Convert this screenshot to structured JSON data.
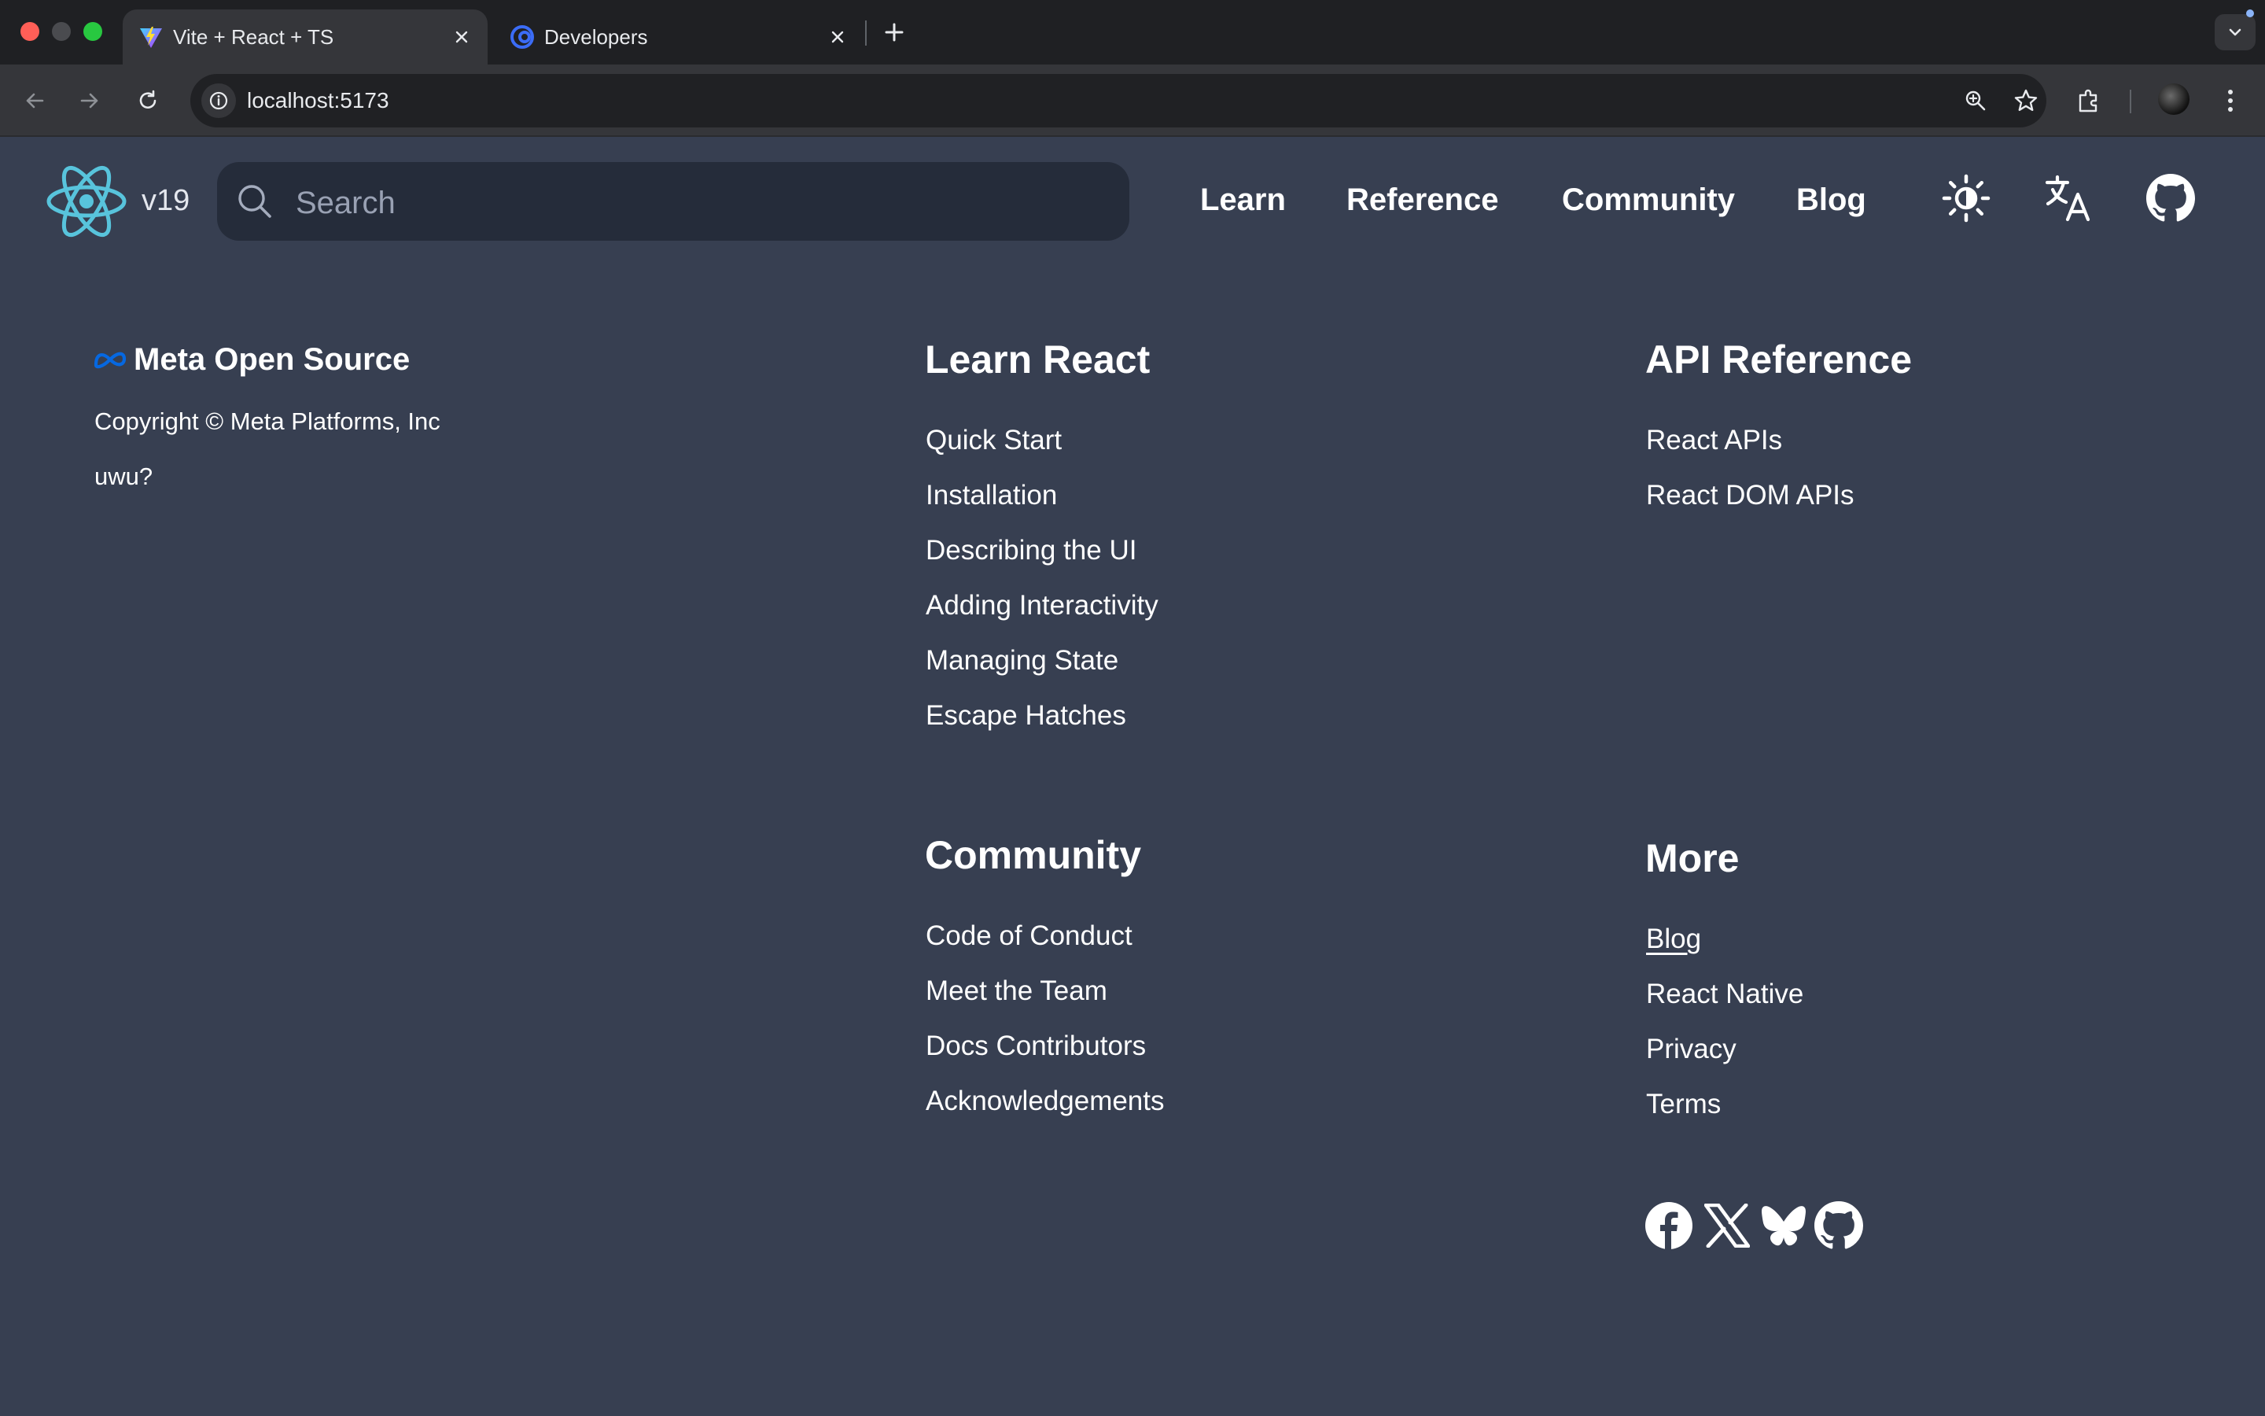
{
  "browser": {
    "tabs": [
      {
        "title": "Vite + React + TS",
        "active": true,
        "favicon": "vite-icon"
      },
      {
        "title": "Developers",
        "active": false,
        "favicon": "developers-icon"
      }
    ],
    "url": "localhost:5173"
  },
  "site": {
    "version": "v19",
    "search_placeholder": "Search",
    "nav": [
      "Learn",
      "Reference",
      "Community",
      "Blog"
    ],
    "nav_icons": [
      "theme-toggle-icon",
      "language-icon",
      "github-icon"
    ]
  },
  "footer": {
    "brand": "Meta Open Source",
    "copyright": "Copyright © Meta Platforms, Inc",
    "uwu": "uwu?",
    "learn": {
      "heading": "Learn React",
      "links": [
        "Quick Start",
        "Installation",
        "Describing the UI",
        "Adding Interactivity",
        "Managing State",
        "Escape Hatches"
      ]
    },
    "api": {
      "heading": "API Reference",
      "links": [
        "React APIs",
        "React DOM APIs"
      ]
    },
    "community": {
      "heading": "Community",
      "links": [
        "Code of Conduct",
        "Meet the Team",
        "Docs Contributors",
        "Acknowledgements"
      ]
    },
    "more": {
      "heading": "More",
      "links": [
        "Blog",
        "React Native",
        "Privacy",
        "Terms"
      ]
    },
    "social_icons": [
      "facebook-icon",
      "x-icon",
      "bluesky-icon",
      "github-icon"
    ]
  },
  "colors": {
    "page_bg": "#373f51",
    "react_blue": "#58c4dc",
    "meta_blue": "#0668e1"
  }
}
